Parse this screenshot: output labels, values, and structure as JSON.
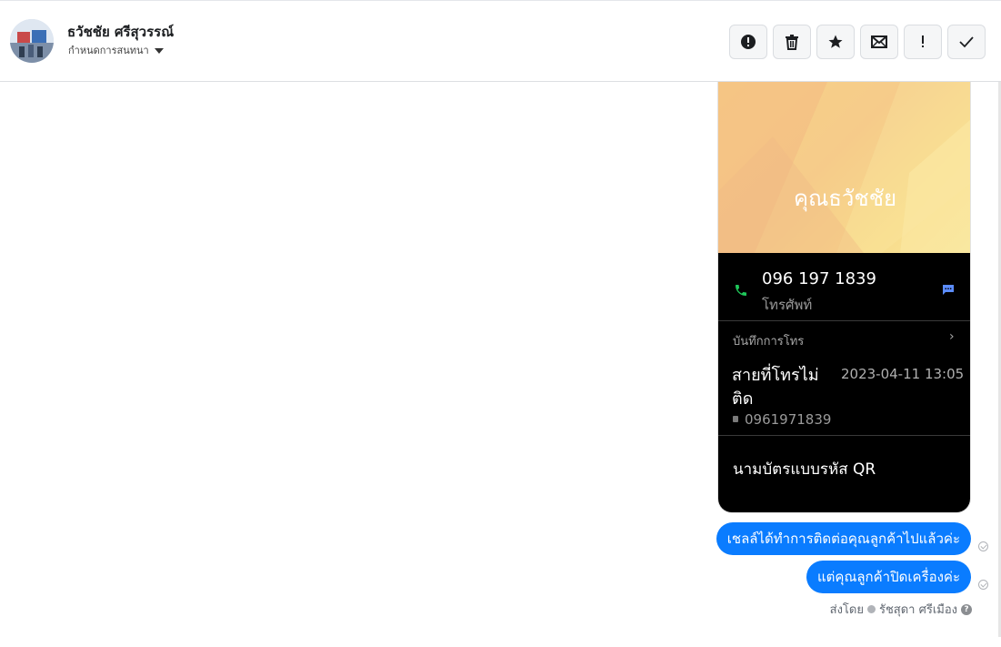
{
  "header": {
    "contact_name": "ธวัชชัย ศรีสุวรรณ์",
    "assign_label": "กำหนดการสนทนา",
    "actions": [
      "spam-icon",
      "trash-icon",
      "star-icon",
      "envelope-icon",
      "exclamation-icon",
      "checkmark-icon"
    ]
  },
  "attachment": {
    "contact_card_name": "คุณธวัชชัย",
    "phone_number": "096 197 1839",
    "phone_label": "โทรศัพท์",
    "call_log_title": "บันทึกการโทร",
    "call_status": "สายที่โทรไม่ติด",
    "call_time": "2023-04-11 13:05",
    "call_number": "0961971839",
    "qr_label": "นามบัตรแบบรหัส QR"
  },
  "messages": [
    {
      "text": "เชลล์ได้ทำการติดต่อคุณลูกค้าไปแล้วค่ะ"
    },
    {
      "text": "แต่คุณลูกค้าปิดเครื่องค่ะ"
    }
  ],
  "sent_by": {
    "prefix": "ส่งโดย",
    "name": "รัชสุดา ศรีเมือง"
  },
  "colors": {
    "bubble": "#0a7cff",
    "phone_green": "#1fc75a",
    "message_blue": "#5b8cff"
  }
}
